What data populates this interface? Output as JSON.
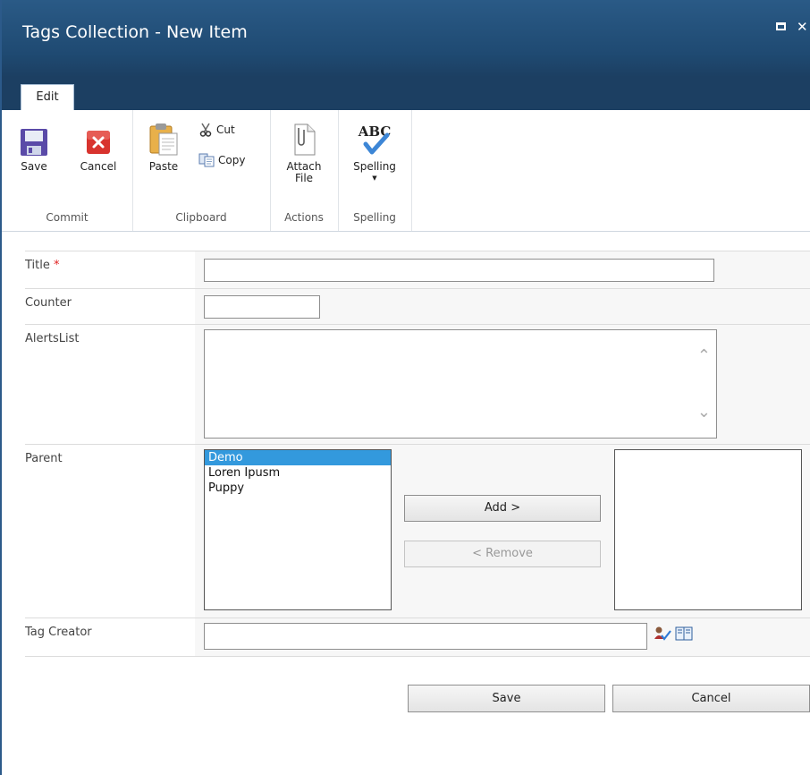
{
  "window": {
    "title": "Tags Collection - New Item",
    "maximize_glyph": "",
    "close_glyph": "✕"
  },
  "ribbon": {
    "tab": "Edit",
    "groups": [
      {
        "name": "Commit",
        "buttons": [
          {
            "label": "Save",
            "icon": "save-icon"
          },
          {
            "label": "Cancel",
            "icon": "cancel-icon"
          }
        ]
      },
      {
        "name": "Clipboard",
        "buttons": [
          {
            "label": "Paste",
            "icon": "paste-icon"
          },
          {
            "label": "Cut",
            "icon": "cut-icon"
          },
          {
            "label": "Copy",
            "icon": "copy-icon"
          }
        ]
      },
      {
        "name": "Actions",
        "buttons": [
          {
            "label_line1": "Attach",
            "label_line2": "File",
            "icon": "attach-file-icon"
          }
        ]
      },
      {
        "name": "Spelling",
        "buttons": [
          {
            "label": "Spelling",
            "icon": "spelling-icon",
            "abc": "ABC"
          }
        ]
      }
    ]
  },
  "form": {
    "title": {
      "label": "Title ",
      "required_marker": "*",
      "value": ""
    },
    "counter": {
      "label": "Counter",
      "value": ""
    },
    "alerts_list": {
      "label": "AlertsList",
      "value": ""
    },
    "parent": {
      "label": "Parent",
      "available": [
        "Demo",
        "Loren Ipusm",
        "Puppy"
      ],
      "selected_index": 0,
      "chosen": [],
      "add_label": "Add >",
      "remove_label": "< Remove"
    },
    "tag_creator": {
      "label": "Tag Creator",
      "value": ""
    }
  },
  "footer": {
    "save_label": "Save",
    "cancel_label": "Cancel"
  }
}
